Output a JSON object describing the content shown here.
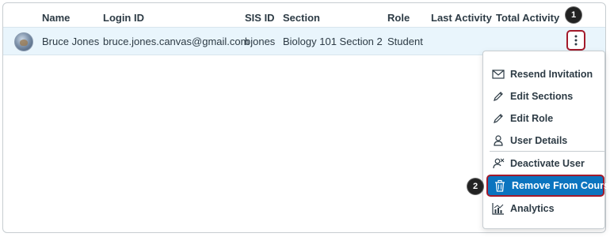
{
  "table": {
    "headers": {
      "name": "Name",
      "login_id": "Login ID",
      "sis_id": "SIS ID",
      "section": "Section",
      "role": "Role",
      "last_activity": "Last Activity",
      "total_activity": "Total Activity"
    },
    "row": {
      "name": "Bruce Jones",
      "login_id": "bruce.jones.canvas@gmail.com",
      "sis_id": "bjones",
      "section": "Biology 101 Section 2",
      "role": "Student",
      "last_activity": "",
      "total_activity": ""
    }
  },
  "menu": {
    "items": [
      {
        "label": "Resend Invitation",
        "icon": "envelope-icon"
      },
      {
        "label": "Edit Sections",
        "icon": "pencil-icon"
      },
      {
        "label": "Edit Role",
        "icon": "pencil-icon"
      },
      {
        "label": "User Details",
        "icon": "user-icon"
      },
      {
        "label": "Deactivate User",
        "icon": "user-x-icon"
      },
      {
        "label": "Remove From Course",
        "icon": "trash-icon"
      },
      {
        "label": "Analytics",
        "icon": "chart-icon"
      }
    ]
  },
  "callouts": {
    "one": "1",
    "two": "2"
  },
  "colors": {
    "link": "#0b74bf",
    "highlight": "#0b74bf",
    "row_bg": "#e9f5fc",
    "callout_border": "#a31a2b"
  }
}
